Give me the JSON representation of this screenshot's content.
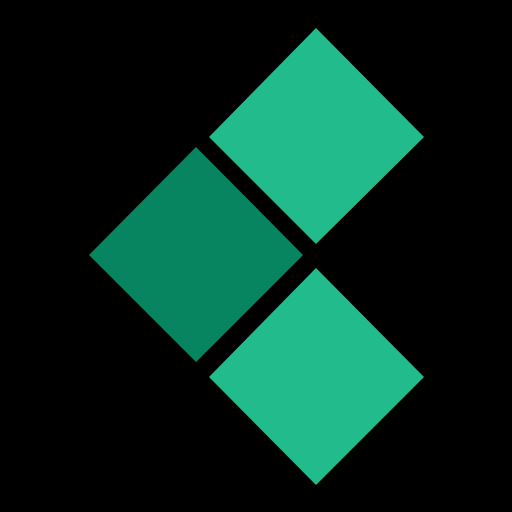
{
  "logo": {
    "icon": "three-diamond-logo-icon",
    "background_color": "#000000",
    "colors": {
      "light_green": "#22BB8B",
      "dark_green": "#078460"
    },
    "tiles": [
      {
        "name": "top-right-diamond",
        "color_key": "light_green"
      },
      {
        "name": "middle-left-diamond",
        "color_key": "dark_green"
      },
      {
        "name": "bottom-right-diamond",
        "color_key": "light_green"
      }
    ]
  }
}
